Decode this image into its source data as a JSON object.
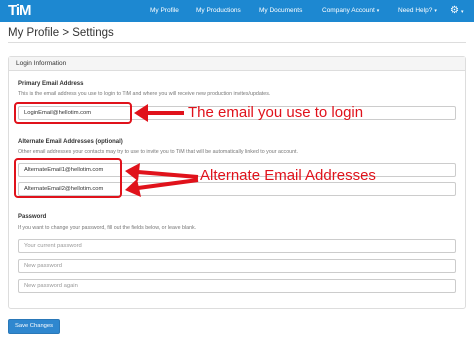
{
  "app": {
    "logo_text": "TiM"
  },
  "navbar": {
    "items": [
      {
        "label": "My Profile"
      },
      {
        "label": "My Productions"
      },
      {
        "label": "My Documents"
      },
      {
        "label": "Company Account",
        "caret": "▾"
      },
      {
        "label": "Need Help?",
        "caret": "▾"
      }
    ],
    "gear_icon": "gear-icon",
    "gear_caret": "▾",
    "bg_color": "#1d88d1"
  },
  "page": {
    "title": "My Profile > Settings"
  },
  "panel": {
    "title": "Login Information"
  },
  "primary": {
    "label": "Primary Email Address",
    "help": "This is the email address you use to login to TiM and where you will receive new production invites/updates.",
    "value": "LoginEmail@hellotim.com"
  },
  "alternate": {
    "label": "Alternate Email Addresses (optional)",
    "help": "Other email addresses your contacts may try to use to invite you to TiM that will be automatically linked to your account.",
    "values": [
      "AlternateEmail1@hellotim.com",
      "AlternateEmail2@hellotim.com"
    ]
  },
  "password": {
    "label": "Password",
    "help": "If you want to change your password, fill out the fields below, or leave blank.",
    "current_placeholder": "Your current password",
    "new_placeholder": "New password",
    "again_placeholder": "New password again"
  },
  "annotations": {
    "login_note": "The email you use to login",
    "alternate_note": "Alternate Email Addresses",
    "color": "#e0121b"
  },
  "actions": {
    "save_label": "Save Changes",
    "button_color": "#2f87cf"
  }
}
